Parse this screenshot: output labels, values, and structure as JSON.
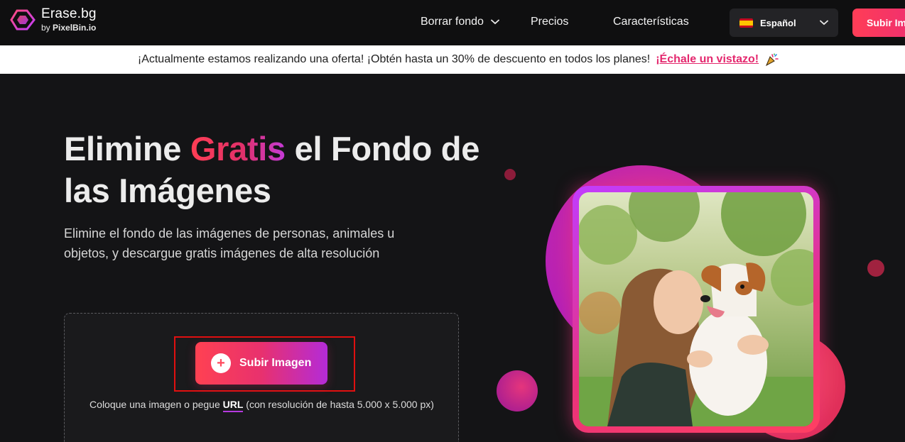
{
  "brand": {
    "title": "Erase.bg",
    "by_prefix": "by",
    "by_name": "PixelBin.io"
  },
  "nav": {
    "items": [
      {
        "label": "Borrar fondo",
        "has_dropdown": true
      },
      {
        "label": "Precios",
        "has_dropdown": false
      },
      {
        "label": "Características",
        "has_dropdown": false
      }
    ],
    "language": {
      "label": "Español",
      "flag": "spain-flag-icon"
    },
    "cta_label": "Subir Imagen"
  },
  "offer": {
    "text": "¡Actualmente estamos realizando una oferta! ¡Obtén hasta un 30% de descuento en todos los planes!",
    "link": "¡Échale un vistazo!",
    "icon": "party-popper-icon"
  },
  "hero": {
    "title_part1": "Elimine ",
    "title_highlight": "Gratis",
    "title_part2": " el Fondo de las Imágenes",
    "subtitle": "Elimine el fondo de las imágenes de personas, animales u objetos, y descargue gratis imágenes de alta resolución"
  },
  "upload": {
    "button_label": "Subir Imagen",
    "hint_before": "Coloque una imagen o pegue ",
    "hint_link": "URL",
    "hint_after": " (con resolución de hasta 5.000 x 5.000 px)"
  },
  "colors": {
    "accent_red": "#ff3e54",
    "accent_pink": "#e4286e",
    "accent_purple": "#b42bd8",
    "background": "#141416",
    "highlight_box": "#e01010"
  }
}
